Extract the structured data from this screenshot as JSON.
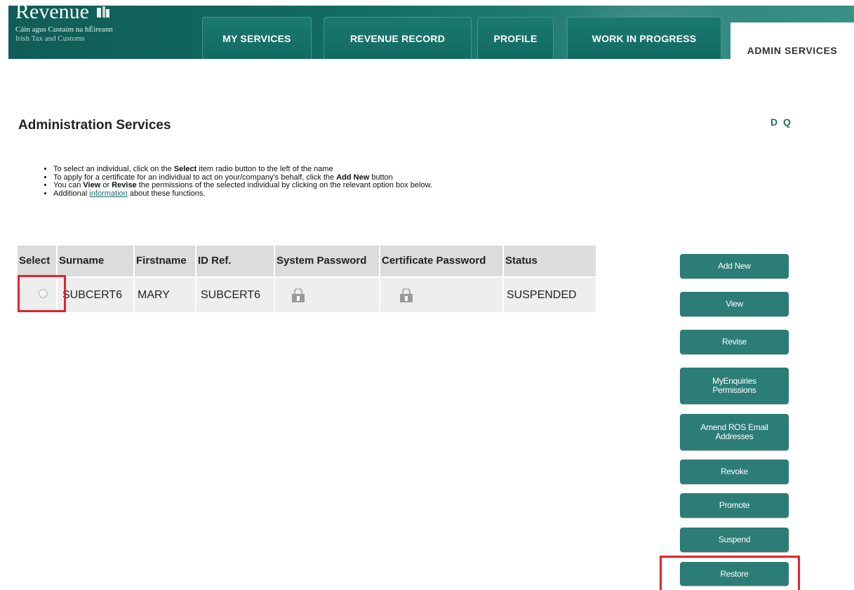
{
  "header": {
    "brand_name": "Revenue",
    "brand_sub_irish": "Cáin agus Custaim na hÉireann",
    "brand_sub_english": "Irish Tax and Customs",
    "tabs": [
      {
        "label": "MY SERVICES"
      },
      {
        "label": "REVENUE RECORD"
      },
      {
        "label": "PROFILE"
      },
      {
        "label": "WORK IN PROGRESS"
      },
      {
        "label": "ADMIN SERVICES",
        "active": true
      }
    ],
    "accent_color": "#136b63"
  },
  "page": {
    "title": "Administration Services",
    "dq": "D Q"
  },
  "instructions": {
    "item1": {
      "a": "To select an individual, click on the ",
      "b": "Select",
      "c": " item radio button to the left of the name"
    },
    "item2": {
      "a": "To apply for a certificate for an individual to act on your/company's behalf, click the ",
      "b": "Add New",
      "c": " button"
    },
    "item3": {
      "a": "You can ",
      "b": "View",
      "c": " or ",
      "d": "Revise",
      "e": " the permissions of the selected individual by clicking on the relevant option box below."
    },
    "item4": {
      "a": "Additional ",
      "link": "information",
      "c": " about these functions."
    }
  },
  "table": {
    "headers": {
      "select": "Select",
      "surname": "Surname",
      "firstname": "Firstname",
      "idref": "ID Ref.",
      "system_password": "System Password",
      "certificate_password": "Certificate Password",
      "status": "Status"
    },
    "rows": [
      {
        "surname": "SUBCERT6",
        "firstname": "MARY",
        "idref": "SUBCERT6",
        "system_password_icon": "lock-icon",
        "certificate_password_icon": "lock-icon",
        "status": "SUSPENDED",
        "selected": false
      }
    ]
  },
  "actions": {
    "add_new": "Add New",
    "view": "View",
    "revise": "Revise",
    "myenquiries": "MyEnquiries Permissions",
    "amend_email": "Amend ROS Email Addresses",
    "revoke": "Revoke",
    "promote": "Promote",
    "suspend": "Suspend",
    "restore": "Restore",
    "button_color": "#2b7d76"
  },
  "highlight_color": "#e0232e"
}
